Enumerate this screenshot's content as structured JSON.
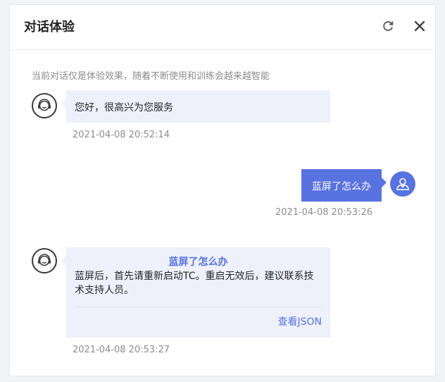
{
  "header": {
    "title": "对话体验"
  },
  "notice": "当前对话仅是体验效果，随着不断使用和训练会越来越智能",
  "messages": [
    {
      "role": "bot",
      "text": "您好，很高兴为您服务",
      "time": "2021-04-08 20:52:14"
    },
    {
      "role": "user",
      "text": "蓝屏了怎么办",
      "time": "2021-04-08 20:53:26"
    },
    {
      "role": "bot",
      "title": "蓝屏了怎么办",
      "text": "蓝屏后，首先请重新启动TC。重启无效后，建议联系技术支持人员。",
      "link": "查看JSON",
      "time": "2021-04-08 20:53:27"
    }
  ],
  "colors": {
    "accent": "#5872e0",
    "bot_bubble": "#eef1fc"
  },
  "icons": {
    "refresh": "refresh-icon",
    "close": "close-icon",
    "bot": "headset-icon",
    "user": "user-icon"
  }
}
